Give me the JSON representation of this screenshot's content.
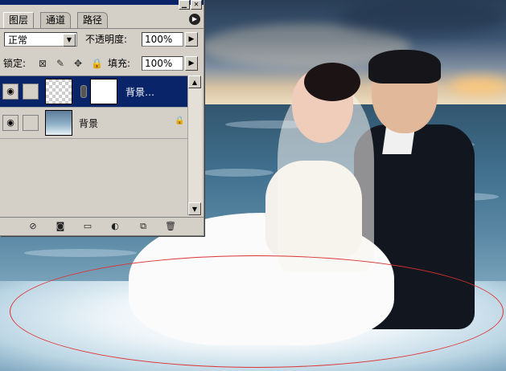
{
  "layers_panel": {
    "tabs": [
      "图层",
      "通道",
      "路径"
    ],
    "blend_mode": "正常",
    "opacity_label": "不透明度:",
    "opacity_value": "100%",
    "lock_label": "锁定:",
    "fill_label": "填充:",
    "fill_value": "100%",
    "layers": [
      {
        "name": "背景…",
        "selected": true
      },
      {
        "name": "背景",
        "selected": false
      }
    ]
  },
  "colors": {
    "selection": "#0a246a",
    "panel_bg": "#d4d0c8",
    "ellipse": "#dd3333"
  }
}
